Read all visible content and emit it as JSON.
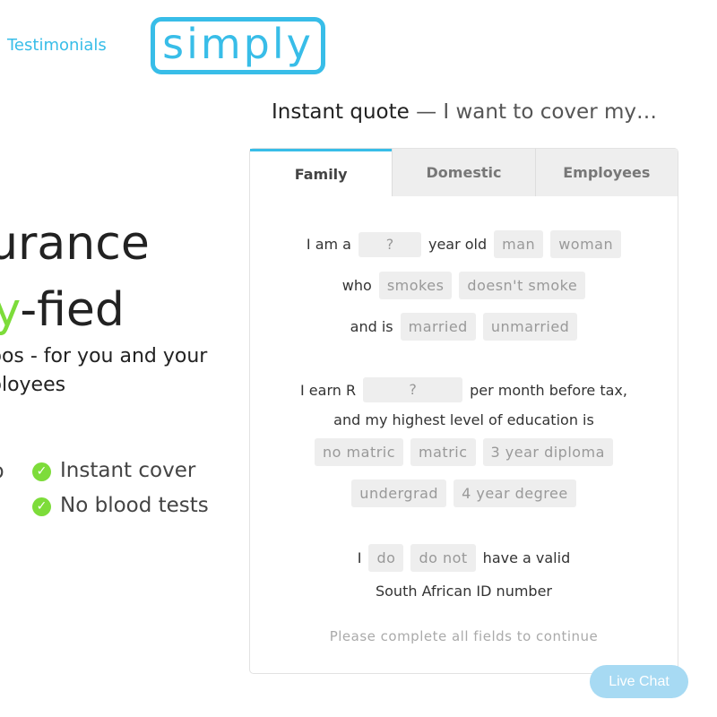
{
  "nav": {
    "testimonials": "Testimonials"
  },
  "logo": {
    "text": "simply"
  },
  "hero": {
    "line1": "surance",
    "line2_accent": "ly",
    "line2_rest": "-fied",
    "sub1": "bos - for you and your",
    "sub2": "ployees",
    "bullet_left": "p",
    "bullets": [
      "Instant cover",
      "No blood tests"
    ]
  },
  "quote": {
    "title_strong": "Instant quote",
    "title_rest": " — I want to cover my…",
    "tabs": [
      "Family",
      "Domestic",
      "Employees"
    ],
    "active_tab": "Family",
    "age_prefix": "I am a",
    "age_placeholder": "?",
    "age_suffix": "year old",
    "gender_options": [
      "man",
      "woman"
    ],
    "who": "who",
    "smoke_options": [
      "smokes",
      "doesn't smoke"
    ],
    "and_is": "and is",
    "marital_options": [
      "married",
      "unmarried"
    ],
    "earn_prefix": "I earn R",
    "earn_placeholder": "?",
    "earn_suffix": "per month before tax,",
    "education_label": "and my highest level of education is",
    "education_options_row1": [
      "no matric",
      "matric",
      "3 year diploma"
    ],
    "education_options_row2": [
      "undergrad",
      "4 year degree"
    ],
    "id_prefix": "I",
    "id_options": [
      "do",
      "do not"
    ],
    "id_suffix": "have a valid",
    "id_line2": "South African ID number",
    "hint": "Please complete all fields to continue"
  },
  "chat": {
    "label": "Live Chat"
  },
  "colors": {
    "brand": "#38bde8",
    "accent_green": "#7ddc3a",
    "chip_bg": "#eeeeee"
  }
}
